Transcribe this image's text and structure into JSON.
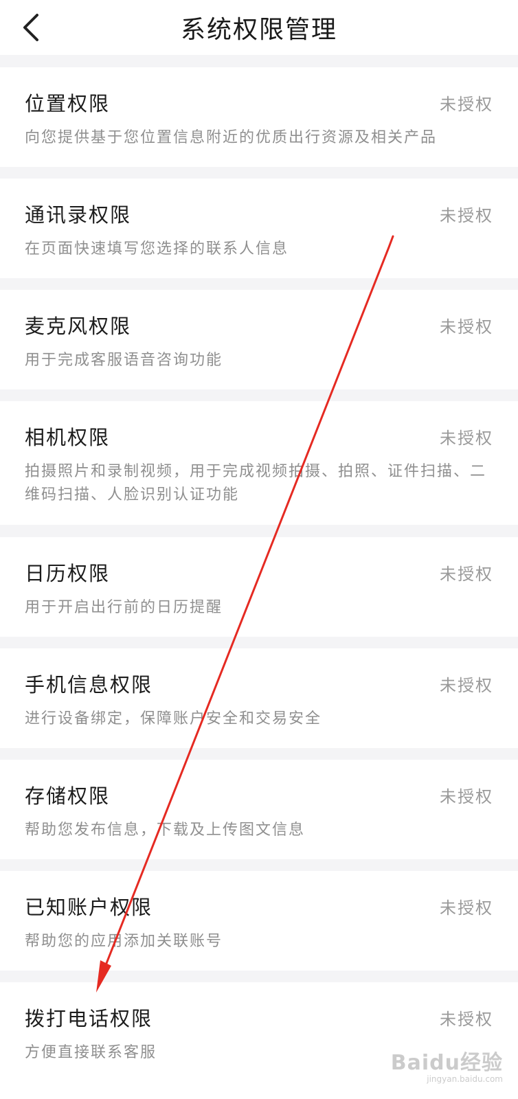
{
  "header": {
    "title": "系统权限管理",
    "back_icon": "chevron-left-icon"
  },
  "permissions": [
    {
      "name": "位置权限",
      "status": "未授权",
      "desc": "向您提供基于您位置信息附近的优质出行资源及相关产品"
    },
    {
      "name": "通讯录权限",
      "status": "未授权",
      "desc": "在页面快速填写您选择的联系人信息"
    },
    {
      "name": "麦克风权限",
      "status": "未授权",
      "desc": "用于完成客服语音咨询功能"
    },
    {
      "name": "相机权限",
      "status": "未授权",
      "desc": "拍摄照片和录制视频，用于完成视频拍摄、拍照、证件扫描、二维码扫描、人脸识别认证功能"
    },
    {
      "name": "日历权限",
      "status": "未授权",
      "desc": "用于开启出行前的日历提醒"
    },
    {
      "name": "手机信息权限",
      "status": "未授权",
      "desc": "进行设备绑定，保障账户安全和交易安全"
    },
    {
      "name": "存储权限",
      "status": "未授权",
      "desc": "帮助您发布信息，下载及上传图文信息"
    },
    {
      "name": "已知账户权限",
      "status": "未授权",
      "desc": "帮助您的应用添加关联账号"
    },
    {
      "name": "拨打电话权限",
      "status": "未授权",
      "desc": "方便直接联系客服"
    }
  ],
  "watermark": {
    "main": "Baidu经验",
    "sub": "jingyan.baidu.com"
  },
  "colors": {
    "background": "#f4f4f6",
    "card": "#ffffff",
    "status_text": "#9a9a9a",
    "desc_text": "#8f8f8f",
    "annotation_arrow": "#e52a22"
  }
}
